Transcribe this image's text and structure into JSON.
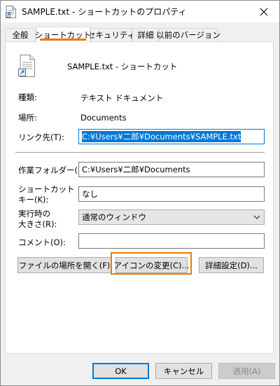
{
  "window": {
    "title": "SAMPLE.txt - ショートカットのプロパティ"
  },
  "tabs": [
    {
      "label": "全般"
    },
    {
      "label": "ショートカット"
    },
    {
      "label": "セキュリティ"
    },
    {
      "label": "詳細"
    },
    {
      "label": "以前のバージョン"
    }
  ],
  "active_tab": "ショートカット",
  "header": {
    "file_name": "SAMPLE.txt - ショートカット"
  },
  "properties": {
    "type_label": "種類:",
    "type_value": "テキスト ドキュメント",
    "location_label": "場所:",
    "location_value": "Documents",
    "target_label": "リンク先(T):",
    "target_value": "C:¥Users¥二郎¥Documents¥SAMPLE.txt",
    "start_in_label": "作業フォルダー(S):",
    "start_in_value": "C:¥Users¥二郎¥Documents",
    "shortcut_key_label_1": "ショートカット",
    "shortcut_key_label_2": "キー(K):",
    "shortcut_key_value": "なし",
    "run_label_1": "実行時の",
    "run_label_2": "大きさ(R):",
    "run_value": "通常のウィンドウ",
    "comment_label": "コメント(O):",
    "comment_value": ""
  },
  "actions": {
    "open_location": "ファイルの場所を開く(F)",
    "change_icon": "アイコンの変更(C)...",
    "advanced": "詳細設定(D)..."
  },
  "footer": {
    "ok": "OK",
    "cancel": "キャンセル",
    "apply": "適用(A)"
  },
  "colors": {
    "highlight": "#f07800",
    "accent": "#0078d7"
  }
}
